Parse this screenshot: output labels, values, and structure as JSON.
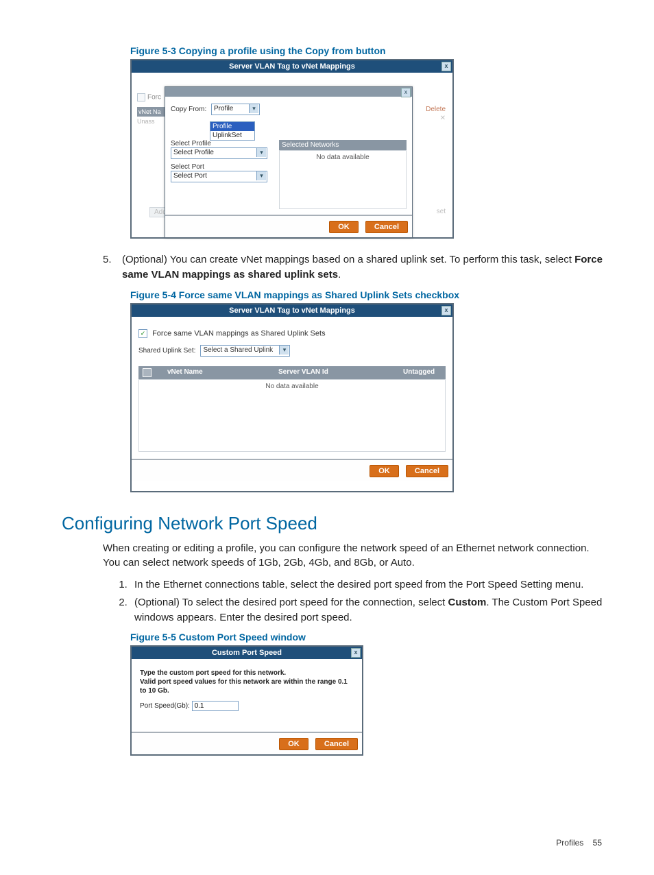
{
  "fig53": {
    "caption": "Figure 5-3 Copying a profile using the Copy from button",
    "outer_title": "Server VLAN Tag to vNet Mappings",
    "bg": {
      "force_label": "Forc",
      "vnet_label": "vNet Na",
      "unass_label": "Unass",
      "add_btn": "Add",
      "delete": "Delete",
      "dot": "set"
    },
    "inner": {
      "copy_from_label": "Copy From:",
      "copy_from_value": "Profile",
      "dd_opt1": "Profile",
      "dd_opt2": "UplinkSet",
      "select_profile_label": "Select Profile",
      "select_profile_value": "Select Profile",
      "select_port_label": "Select Port",
      "select_port_value": "Select Port",
      "sel_net_header": "Selected Networks",
      "sel_net_empty": "No data available",
      "ok": "OK",
      "cancel": "Cancel"
    }
  },
  "step5": {
    "num": "5.",
    "text_a": "(Optional) You can create vNet mappings based on a shared uplink set. To perform this task, select ",
    "text_b": "Force same VLAN mappings as shared uplink sets",
    "text_c": "."
  },
  "fig54": {
    "caption": "Figure 5-4 Force same VLAN mappings as Shared Uplink Sets checkbox",
    "title": "Server VLAN Tag to vNet Mappings",
    "chk_label": "Force same VLAN mappings as Shared Uplink Sets",
    "sus_label": "Shared Uplink Set:",
    "sus_value": "Select a Shared Uplink",
    "col_vnet": "vNet Name",
    "col_vlan": "Server VLAN Id",
    "col_untag": "Untagged",
    "empty": "No data available",
    "ok": "OK",
    "cancel": "Cancel"
  },
  "section_heading": "Configuring Network Port Speed",
  "para1": "When creating or editing a profile, you can configure the network speed of an Ethernet network connection. You can select network speeds of 1Gb, 2Gb, 4Gb, and 8Gb, or Auto.",
  "ol": {
    "i1": "In the Ethernet connections table, select the desired port speed from the Port Speed Setting menu.",
    "i2_a": "(Optional) To select the desired port speed for the connection, select ",
    "i2_b": "Custom",
    "i2_c": ". The Custom Port Speed windows appears. Enter the desired port speed."
  },
  "fig55": {
    "caption": "Figure 5-5 Custom Port Speed window",
    "title": "Custom Port Speed",
    "line1": "Type the custom port speed for this network.",
    "line2": "Valid port speed values for this network are within the range 0.1 to 10 Gb.",
    "field_label": "Port Speed(Gb):",
    "field_value": "0.1",
    "ok": "OK",
    "cancel": "Cancel"
  },
  "footer": {
    "label": "Profiles",
    "page": "55"
  }
}
